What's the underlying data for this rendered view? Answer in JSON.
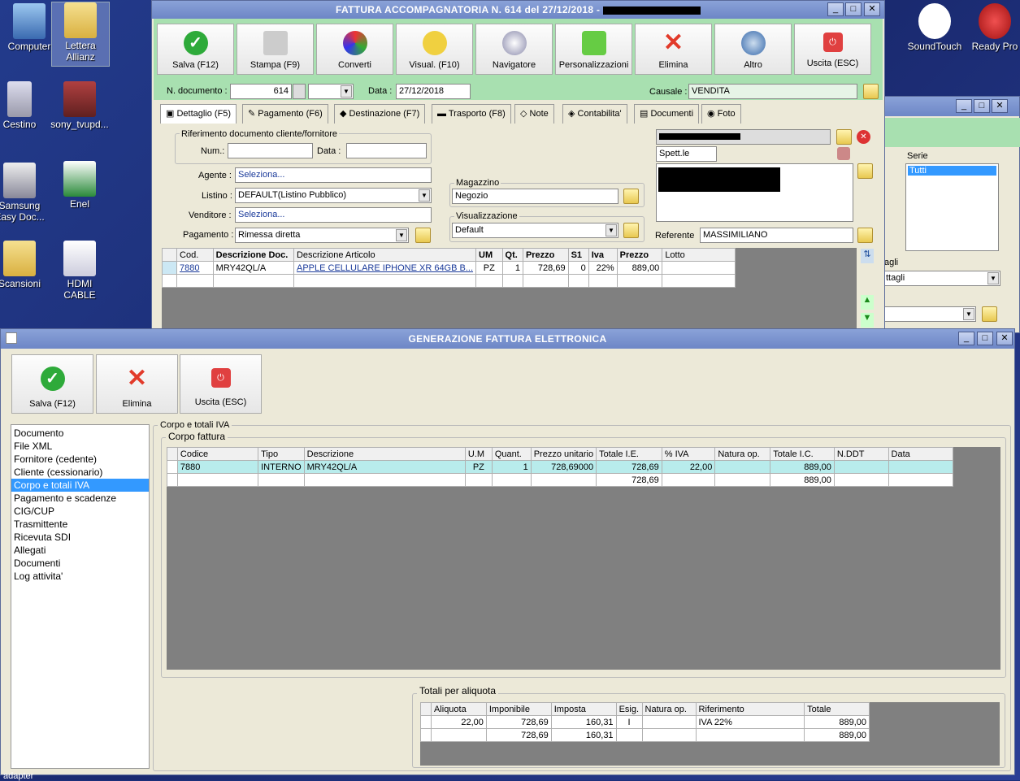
{
  "desktop": {
    "icons": [
      "Computer",
      "Lettera Allianz",
      "Cestino",
      "sony_tvupd...",
      "Samsung Easy Doc...",
      "Enel",
      "Scansioni",
      "HDMI CABLE",
      "SoundTouch",
      "Ready Pro"
    ],
    "taskbar_text": "adapter"
  },
  "main": {
    "title": "FATTURA ACCOMPAGNATORIA N. 614 del 27/12/2018 -",
    "toolbar": [
      "Salva (F12)",
      "Stampa (F9)",
      "Converti",
      "Visual. (F10)",
      "Navigatore",
      "Personalizzazioni",
      "Elimina",
      "Altro",
      "Uscita (ESC)"
    ],
    "ndoc_label": "N. documento :",
    "ndoc_value": "614",
    "data_label": "Data :",
    "data_value": "27/12/2018",
    "causale_label": "Causale :",
    "causale_value": "VENDITA",
    "tabs": [
      "Dettaglio (F5)",
      "Pagamento (F6)",
      "Destinazione (F7)",
      "Trasporto (F8)",
      "Note",
      "Contabilita'",
      "Documenti",
      "Foto"
    ],
    "rif_group": "Riferimento documento cliente/fornitore",
    "num_label": "Num.:",
    "data2_label": "Data :",
    "agente_label": "Agente :",
    "agente_value": "Seleziona...",
    "listino_label": "Listino :",
    "listino_value": "DEFAULT(Listino Pubblico)",
    "venditore_label": "Venditore :",
    "venditore_value": "Seleziona...",
    "pagamento_label": "Pagamento :",
    "pagamento_value": "Rimessa diretta",
    "magazzino_label": "Magazzino",
    "magazzino_value": "Negozio",
    "visual_label": "Visualizzazione",
    "visual_value": "Default",
    "spett": "Spett.le",
    "referente_label": "Referente",
    "referente_value": "MASSIMILIANO",
    "grid_headers": [
      "Cod.",
      "Descrizione Doc.",
      "Descrizione Articolo",
      "UM",
      "Qt.",
      "Prezzo",
      "S1",
      "Iva",
      "Prezzo",
      "Lotto"
    ],
    "grid_row": [
      "7880",
      "MRY42QL/A",
      "APPLE CELLULARE IPHONE XR 64GB B...",
      "PZ",
      "1",
      "728,69",
      "0",
      "22%",
      "889,00",
      ""
    ]
  },
  "side": {
    "serie_label": "Serie",
    "serie_value": "Tutti",
    "agli_label": "agli",
    "agli_value": "ttagli"
  },
  "efatt": {
    "title": "GENERAZIONE FATTURA ELETTRONICA",
    "toolbar": [
      "Salva (F12)",
      "Elimina",
      "Uscita (ESC)"
    ],
    "nav": [
      "Documento",
      "File XML",
      "Fornitore (cedente)",
      "Cliente (cessionario)",
      "Corpo e totali IVA",
      "Pagamento e scadenze",
      "CIG/CUP",
      "Trasmittente",
      "Ricevuta SDI",
      "Allegati",
      "Documenti",
      "Log attivita'"
    ],
    "section_title": "Corpo e totali IVA",
    "corpo_label": "Corpo fattura",
    "corpo_headers": [
      "Codice",
      "Tipo",
      "Descrizione",
      "U.M",
      "Quant.",
      "Prezzo unitario",
      "Totale I.E.",
      "% IVA",
      "Natura op.",
      "Totale I.C.",
      "N.DDT",
      "Data"
    ],
    "corpo_rows": [
      [
        "7880",
        "INTERNO",
        "MRY42QL/A",
        "PZ",
        "1",
        "728,69000",
        "728,69",
        "22,00",
        "",
        "889,00",
        "",
        ""
      ],
      [
        "",
        "",
        "",
        "",
        "",
        "",
        "728,69",
        "",
        "",
        "889,00",
        "",
        ""
      ]
    ],
    "totali_label": "Totali per aliquota",
    "totali_headers": [
      "Aliquota",
      "Imponibile",
      "Imposta",
      "Esig.",
      "Natura op.",
      "Riferimento",
      "Totale"
    ],
    "totali_rows": [
      [
        "22,00",
        "728,69",
        "160,31",
        "I",
        "",
        "IVA 22%",
        "889,00"
      ],
      [
        "",
        "728,69",
        "160,31",
        "",
        "",
        "",
        "889,00"
      ]
    ]
  }
}
